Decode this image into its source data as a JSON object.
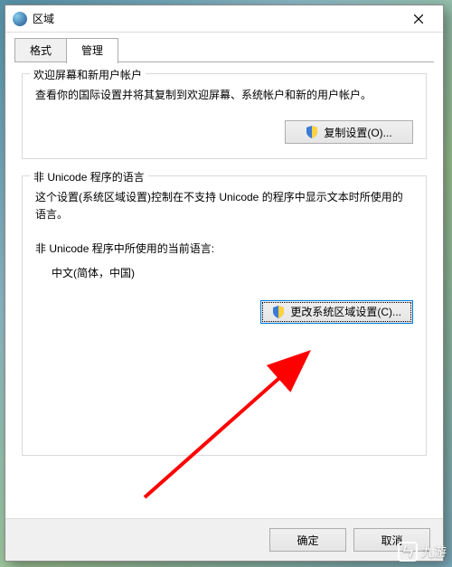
{
  "window": {
    "title": "区域"
  },
  "tabs": {
    "format": "格式",
    "admin": "管理"
  },
  "group_welcome": {
    "legend": "欢迎屏幕和新用户帐户",
    "desc": "查看你的国际设置并将其复制到欢迎屏幕、系统帐户和新的用户帐户。",
    "copy_button": "复制设置(O)..."
  },
  "group_nonunicode": {
    "legend": "非 Unicode 程序的语言",
    "desc": "这个设置(系统区域设置)控制在不支持 Unicode 的程序中显示文本时所使用的语言。",
    "current_label": "非 Unicode 程序中所使用的当前语言:",
    "current_value": "中文(简体，中国)",
    "change_button": "更改系统区域设置(C)..."
  },
  "buttons": {
    "ok": "确定",
    "cancel": "取消"
  },
  "watermark": {
    "logo": "ㄣ",
    "text": "九游"
  }
}
